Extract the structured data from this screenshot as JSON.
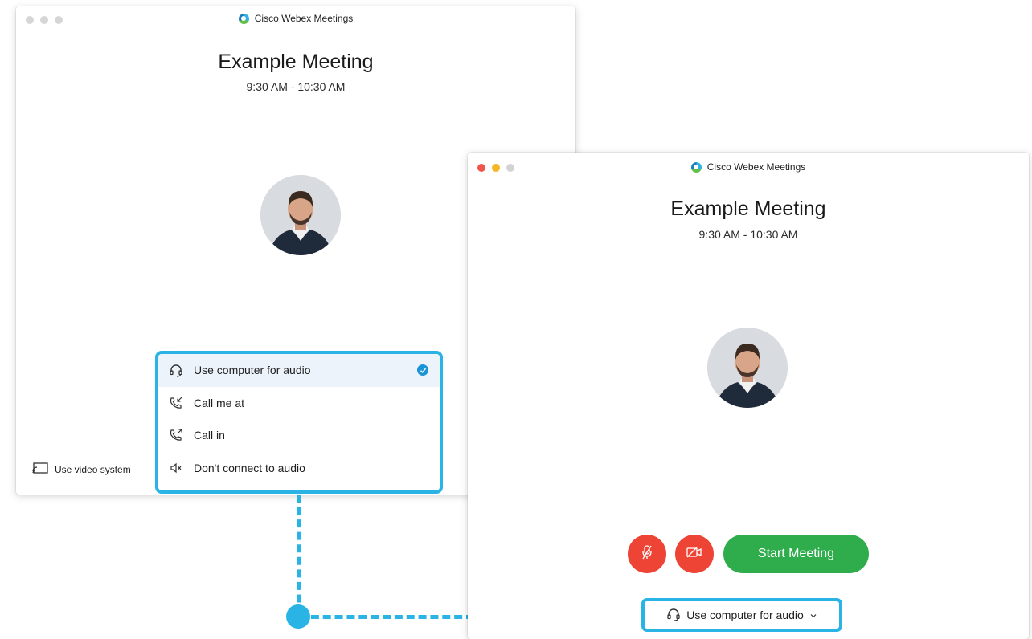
{
  "back_window": {
    "app_title": "Cisco Webex Meetings",
    "meeting_title": "Example Meeting",
    "meeting_time": "9:30 AM - 10:30 AM",
    "video_system_label": "Use video system"
  },
  "audio_menu": {
    "items": [
      {
        "label": "Use computer for audio",
        "icon": "headset-icon",
        "selected": true
      },
      {
        "label": "Call me at",
        "icon": "incoming-call-icon",
        "selected": false
      },
      {
        "label": "Call in",
        "icon": "outgoing-call-icon",
        "selected": false
      },
      {
        "label": "Don't connect to audio",
        "icon": "speaker-muted-icon",
        "selected": false
      }
    ]
  },
  "front_window": {
    "app_title": "Cisco Webex Meetings",
    "meeting_title": "Example Meeting",
    "meeting_time": "9:30 AM - 10:30 AM",
    "start_button_label": "Start Meeting",
    "audio_selector_label": "Use computer for audio"
  },
  "colors": {
    "highlight": "#29b4e5",
    "start_button": "#2fad4c",
    "control_red": "#ee4436",
    "check_blue": "#1b94d7"
  }
}
